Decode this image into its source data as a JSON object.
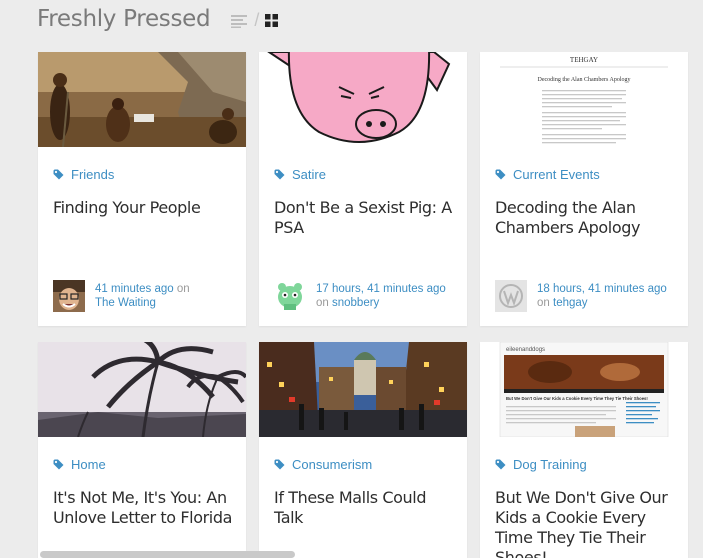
{
  "header": {
    "title": "Freshly Pressed",
    "separator": "/"
  },
  "colors": {
    "accent": "#3d8ec3",
    "background": "#ececec",
    "title_text": "#7a7a7a",
    "body_text": "#2e2e2e",
    "muted_text": "#9a9a9a"
  },
  "icons": {
    "view_list": "list-view-icon",
    "view_grid": "grid-view-icon",
    "category": "tag-icon"
  },
  "posts": [
    {
      "category": "Friends",
      "title": "Finding Your People",
      "time": "41 minutes ago",
      "on": "on",
      "blog": "The Waiting",
      "thumbnail": "cave-people-diorama",
      "avatar": "smiling-man-with-glasses"
    },
    {
      "category": "Satire",
      "title": "Don't Be a Sexist Pig: A PSA",
      "time": "17 hours, 41 minutes ago",
      "on": "on",
      "blog": "snobbery",
      "thumbnail": "pink-pig-drawing",
      "avatar": "green-robot"
    },
    {
      "category": "Current Events",
      "title": "Decoding the Alan Chambers Apology",
      "time": "18 hours, 41 minutes ago",
      "on": "on",
      "blog": "tehgay",
      "thumbnail": "blog-page-screenshot",
      "avatar": "wordpress-logo",
      "thumbnail_text": {
        "site": "TEHGAY",
        "headline": "Decoding the Alan Chambers Apology"
      }
    },
    {
      "category": "Home",
      "title": "It's Not Me, It's You: An Unlove Letter to Florida",
      "thumbnail": "palm-trees"
    },
    {
      "category": "Consumerism",
      "title": "If These Malls Could Talk",
      "thumbnail": "city-street-at-dusk"
    },
    {
      "category": "Dog Training",
      "title": "But We Don't Give Our Kids a Cookie Every Time They Tie Their Shoes!",
      "thumbnail": "dog-blog-screenshot",
      "thumbnail_text": {
        "site": "eileenanddogs",
        "headline": "But We Don't Give Our Kids a Cookie Every Time They Tie Their Shoes!"
      }
    }
  ]
}
